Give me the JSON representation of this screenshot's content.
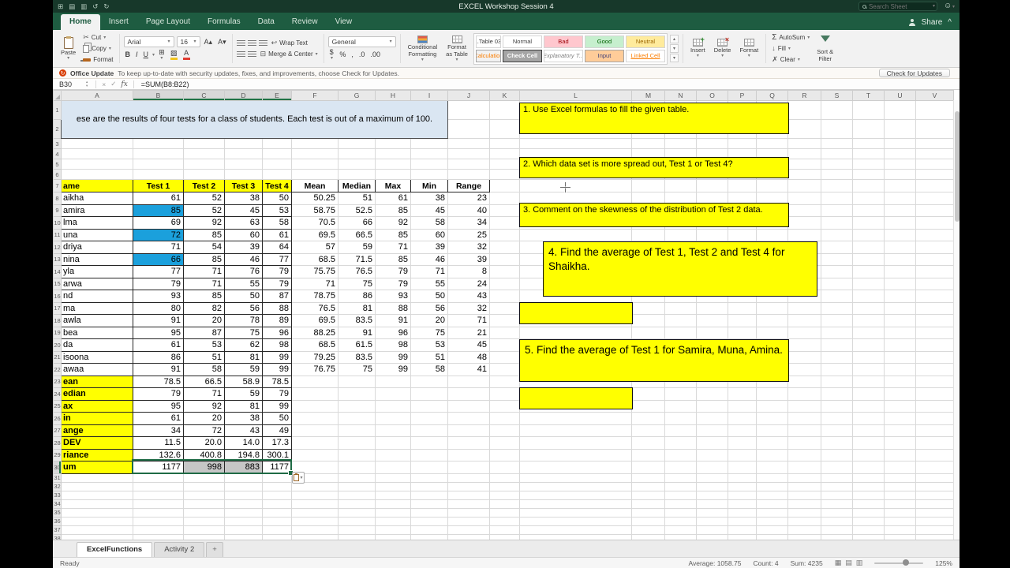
{
  "titlebar": {
    "title": "EXCEL Workshop Session 4",
    "search_placeholder": "Search Sheet"
  },
  "tabs": [
    "Home",
    "Insert",
    "Page Layout",
    "Formulas",
    "Data",
    "Review",
    "View"
  ],
  "share_label": "Share",
  "ribbon": {
    "paste": "Paste",
    "cut": "Cut",
    "copy": "Copy",
    "format_painter": "Format",
    "font_name": "Arial",
    "font_size": "16",
    "bold": "B",
    "italic": "I",
    "underline": "U",
    "wrap_text": "Wrap Text",
    "merge_center": "Merge & Center",
    "number_format": "General",
    "conditional_formatting_1": "Conditional",
    "conditional_formatting_2": "Formatting",
    "format_as_table_1": "Format",
    "format_as_table_2": "as Table",
    "styles_row1": [
      "..Table 03",
      "Normal",
      "Bad",
      "Good",
      "Neutral"
    ],
    "styles_row2": [
      "Calculation",
      "Check Cell",
      "Explanatory T...",
      "Input",
      "Linked Cell"
    ],
    "insert": "Insert",
    "delete": "Delete",
    "format": "Format",
    "autosum": "AutoSum",
    "fill": "Fill",
    "clear": "Clear",
    "sort_filter_1": "Sort &",
    "sort_filter_2": "Filter"
  },
  "notice": {
    "title": "Office Update",
    "text": "To keep up-to-date with security updates, fixes, and improvements, choose Check for Updates.",
    "button": "Check for Updates"
  },
  "formula_bar": {
    "name_box": "B30",
    "formula": "=SUM(B8:B22)"
  },
  "grid": {
    "columns": [
      "A",
      "B",
      "C",
      "D",
      "E",
      "F",
      "G",
      "H",
      "I",
      "J",
      "K",
      "L",
      "M",
      "N",
      "O",
      "P",
      "Q",
      "R",
      "S",
      "T",
      "U",
      "V"
    ],
    "row_count": 38,
    "title_cell": "ese are the results of four tests for a class of students.  Each test is out of a maximum of 100.",
    "header_row": [
      "ame",
      "Test 1",
      "Test 2",
      "Test 3",
      "Test 4",
      "Mean",
      "Median",
      "Max",
      "Min",
      "Range"
    ],
    "students": [
      {
        "name": "aikha",
        "scores": [
          "61",
          "52",
          "38",
          "50"
        ],
        "stats": [
          "50.25",
          "51",
          "61",
          "38",
          "23"
        ],
        "hl": false
      },
      {
        "name": "amira",
        "scores": [
          "85",
          "52",
          "45",
          "53"
        ],
        "stats": [
          "58.75",
          "52.5",
          "85",
          "45",
          "40"
        ],
        "hl": true
      },
      {
        "name": "lma",
        "scores": [
          "69",
          "92",
          "63",
          "58"
        ],
        "stats": [
          "70.5",
          "66",
          "92",
          "58",
          "34"
        ],
        "hl": false
      },
      {
        "name": "una",
        "scores": [
          "72",
          "85",
          "60",
          "61"
        ],
        "stats": [
          "69.5",
          "66.5",
          "85",
          "60",
          "25"
        ],
        "hl": true
      },
      {
        "name": "driya",
        "scores": [
          "71",
          "54",
          "39",
          "64"
        ],
        "stats": [
          "57",
          "59",
          "71",
          "39",
          "32"
        ],
        "hl": false
      },
      {
        "name": "nina",
        "scores": [
          "66",
          "85",
          "46",
          "77"
        ],
        "stats": [
          "68.5",
          "71.5",
          "85",
          "46",
          "39"
        ],
        "hl": true
      },
      {
        "name": "yla",
        "scores": [
          "77",
          "71",
          "76",
          "79"
        ],
        "stats": [
          "75.75",
          "76.5",
          "79",
          "71",
          "8"
        ],
        "hl": false
      },
      {
        "name": "arwa",
        "scores": [
          "79",
          "71",
          "55",
          "79"
        ],
        "stats": [
          "71",
          "75",
          "79",
          "55",
          "24"
        ],
        "hl": false
      },
      {
        "name": "nd",
        "scores": [
          "93",
          "85",
          "50",
          "87"
        ],
        "stats": [
          "78.75",
          "86",
          "93",
          "50",
          "43"
        ],
        "hl": false
      },
      {
        "name": "ma",
        "scores": [
          "80",
          "82",
          "56",
          "88"
        ],
        "stats": [
          "76.5",
          "81",
          "88",
          "56",
          "32"
        ],
        "hl": false
      },
      {
        "name": "awla",
        "scores": [
          "91",
          "20",
          "78",
          "89"
        ],
        "stats": [
          "69.5",
          "83.5",
          "91",
          "20",
          "71"
        ],
        "hl": false
      },
      {
        "name": "bea",
        "scores": [
          "95",
          "87",
          "75",
          "96"
        ],
        "stats": [
          "88.25",
          "91",
          "96",
          "75",
          "21"
        ],
        "hl": false
      },
      {
        "name": "da",
        "scores": [
          "61",
          "53",
          "62",
          "98"
        ],
        "stats": [
          "68.5",
          "61.5",
          "98",
          "53",
          "45"
        ],
        "hl": false
      },
      {
        "name": "isoona",
        "scores": [
          "86",
          "51",
          "81",
          "99"
        ],
        "stats": [
          "79.25",
          "83.5",
          "99",
          "51",
          "48"
        ],
        "hl": false
      },
      {
        "name": "awaa",
        "scores": [
          "91",
          "58",
          "59",
          "99"
        ],
        "stats": [
          "76.75",
          "75",
          "99",
          "58",
          "41"
        ],
        "hl": false
      }
    ],
    "summary": [
      {
        "label": "ean",
        "values": [
          "78.5",
          "66.5",
          "58.9",
          "78.5"
        ]
      },
      {
        "label": "edian",
        "values": [
          "79",
          "71",
          "59",
          "79"
        ]
      },
      {
        "label": "ax",
        "values": [
          "95",
          "92",
          "81",
          "99"
        ]
      },
      {
        "label": "in",
        "values": [
          "61",
          "20",
          "38",
          "50"
        ]
      },
      {
        "label": "ange",
        "values": [
          "34",
          "72",
          "43",
          "49"
        ]
      },
      {
        "label": "DEV",
        "values": [
          "11.5",
          "20.0",
          "14.0",
          "17.3"
        ]
      },
      {
        "label": "riance",
        "values": [
          "132.6",
          "400.8",
          "194.8",
          "300.1"
        ]
      },
      {
        "label": "um",
        "values": [
          "1177",
          "998",
          "883",
          "1177"
        ]
      }
    ]
  },
  "boxes": {
    "q1": "1. Use Excel formulas to fill the given table.",
    "q2": "2. Which data set is more spread out, Test 1 or Test 4?",
    "q3": "3. Comment on the skewness of  the distribution of Test 2 data.",
    "q4": "4. Find the average of Test 1, Test 2 and Test 4 for Shaikha.",
    "q5": "5. Find the average of Test 1 for Samira, Muna, Amina."
  },
  "sheet_tabs": {
    "active": "ExcelFunctions",
    "inactive": "Activity 2",
    "add": "+"
  },
  "status": {
    "ready": "Ready",
    "average": "Average: 1058.75",
    "count": "Count: 4",
    "sum": "Sum: 4235",
    "zoom": "125%"
  }
}
